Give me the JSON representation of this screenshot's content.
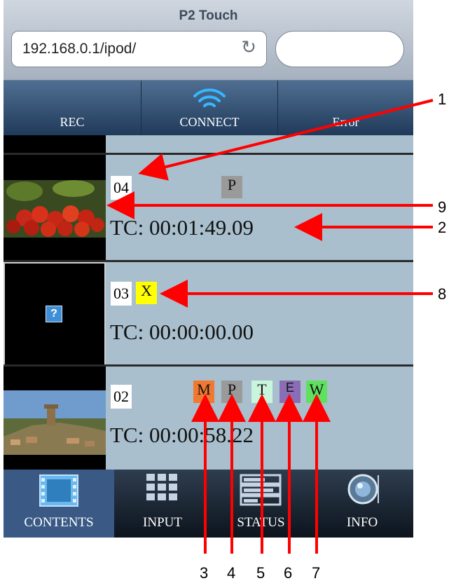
{
  "browser": {
    "title": "P2 Touch",
    "url": "192.168.0.1/ipod/",
    "reload_icon": "reload-icon"
  },
  "toolbar": {
    "rec_label": "REC",
    "connect_label": "CONNECT",
    "error_label": "Error",
    "connect_icon": "wifi-icon"
  },
  "clips": [
    {
      "number": "04",
      "timecode": "TC: 00:01:49.09",
      "badges": [
        "P"
      ]
    },
    {
      "number": "03",
      "timecode": "TC: 00:00:00.00",
      "badges": [
        "X"
      ],
      "thumbnail_placeholder": "?"
    },
    {
      "number": "02",
      "timecode": "TC: 00:00:58.22",
      "badges": [
        "M",
        "P",
        "T",
        "E",
        "W"
      ]
    }
  ],
  "tabs": [
    {
      "label": "CONTENTS",
      "icon": "film-icon",
      "active": true
    },
    {
      "label": "INPUT",
      "icon": "grid-icon",
      "active": false
    },
    {
      "label": "STATUS",
      "icon": "status-bars-icon",
      "active": false
    },
    {
      "label": "INFO",
      "icon": "info-lens-icon",
      "active": false
    }
  ],
  "annotations": [
    "1",
    "2",
    "3",
    "4",
    "5",
    "6",
    "7",
    "8",
    "9"
  ],
  "colors": {
    "badge_M": "#f07830",
    "badge_P": "#9a9a9a",
    "badge_T": "#c8f5dc",
    "badge_E": "#8a6db5",
    "badge_W": "#5fe05f",
    "badge_X": "#ffff00",
    "arrow": "#ff0000",
    "list_bg": "#a9bfcd"
  }
}
